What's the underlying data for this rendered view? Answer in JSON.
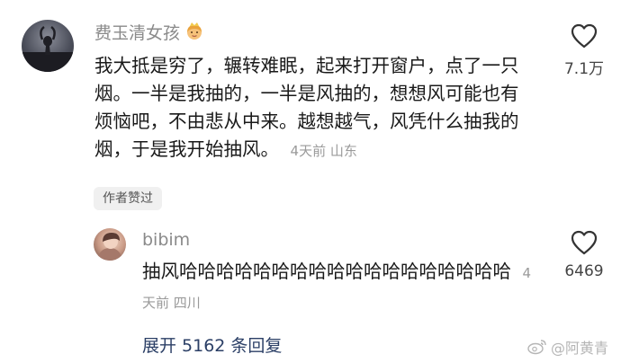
{
  "comment": {
    "username": "费玉清女孩",
    "name_emoji": "princess-emoji",
    "text": "我大抵是穷了，辗转难眠，起来打开窗户，点了一只烟。一半是我抽的，一半是风抽的，想想风可能也有烦恼吧，不由悲从中来。越想越气，风凭什么抽我的烟，于是我开始抽风。",
    "time": "4天前",
    "location": "山东",
    "like_count": "7.1万",
    "author_badge": "作者赞过"
  },
  "reply": {
    "username": "bibim",
    "text": "抽风哈哈哈哈哈哈哈哈哈哈哈哈哈哈哈哈哈哈",
    "time": "4天前",
    "location": "四川",
    "like_count": "6469"
  },
  "expand_replies": "展开 5162 条回复",
  "watermark": "@阿黄青",
  "colors": {
    "link": "#2b3f66",
    "meta": "#9a9a9a",
    "text": "#1a1a1a"
  }
}
